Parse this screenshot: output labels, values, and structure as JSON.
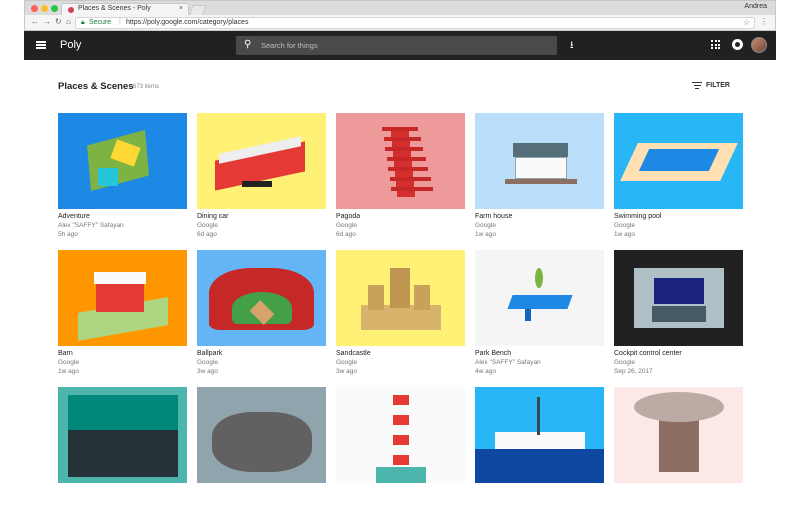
{
  "browser": {
    "tab_title": "Places & Scenes - Poly",
    "tab_close": "×",
    "user_name": "Andrea",
    "secure_label": "Secure",
    "url": "https://poly.google.com/category/places"
  },
  "appbar": {
    "brand": "Poly",
    "search_placeholder": "Search for things"
  },
  "page": {
    "title": "Places & Scenes",
    "count": "673 items",
    "filter_label": "FILTER"
  },
  "cards": [
    {
      "title": "Adventure",
      "author": "Alex \"SAFFY\" Safayan",
      "time": "5h ago",
      "bg": "#1e88e5"
    },
    {
      "title": "Dining car",
      "author": "Google",
      "time": "6d ago",
      "bg": "#fff176"
    },
    {
      "title": "Pagoda",
      "author": "Google",
      "time": "6d ago",
      "bg": "#ef9a9a"
    },
    {
      "title": "Farm house",
      "author": "Google",
      "time": "1w ago",
      "bg": "#bbdefb"
    },
    {
      "title": "Swimming pool",
      "author": "Google",
      "time": "1w ago",
      "bg": "#29b6f6"
    },
    {
      "title": "Barn",
      "author": "Google",
      "time": "1w ago",
      "bg": "#ff9800"
    },
    {
      "title": "Ballpark",
      "author": "Google",
      "time": "3w ago",
      "bg": "#64b5f6"
    },
    {
      "title": "Sandcastle",
      "author": "Google",
      "time": "3w ago",
      "bg": "#fff176"
    },
    {
      "title": "Park Bench",
      "author": "Alex \"SAFFY\" Safayan",
      "time": "4w ago",
      "bg": "#f5f5f5"
    },
    {
      "title": "Cockpit control center",
      "author": "Google",
      "time": "Sep 26, 2017",
      "bg": "#212121"
    },
    {
      "title": "",
      "author": "",
      "time": "",
      "bg": "#4db6ac"
    },
    {
      "title": "",
      "author": "",
      "time": "",
      "bg": "#90a4ae"
    },
    {
      "title": "",
      "author": "",
      "time": "",
      "bg": "#fafafa"
    },
    {
      "title": "",
      "author": "",
      "time": "",
      "bg": "#29b6f6"
    },
    {
      "title": "",
      "author": "",
      "time": "",
      "bg": "#fbe9e7"
    }
  ]
}
